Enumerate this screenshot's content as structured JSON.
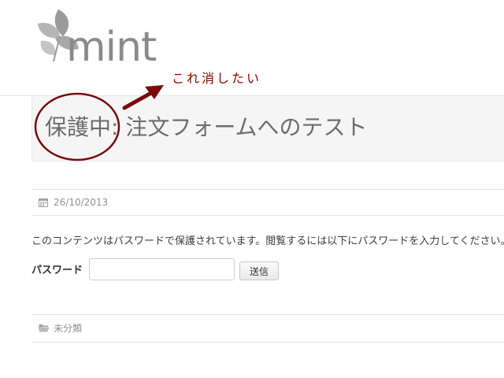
{
  "site": {
    "logo_text": "mint"
  },
  "post": {
    "title": "保護中: 注文フォームへのテスト",
    "date": "26/10/2013",
    "protected_message": "このコンテンツはパスワードで保護されています。閲覧するには以下にパスワードを入力してください。",
    "password_label": "パスワード",
    "password_value": "",
    "submit_label": "送信",
    "category": "未分類"
  },
  "annotation": {
    "note_text": "これ消したい",
    "color": "#8b0000"
  },
  "icons": {
    "logo": "leaf-logo-icon",
    "date": "calendar-icon",
    "category": "folder-open-icon"
  }
}
